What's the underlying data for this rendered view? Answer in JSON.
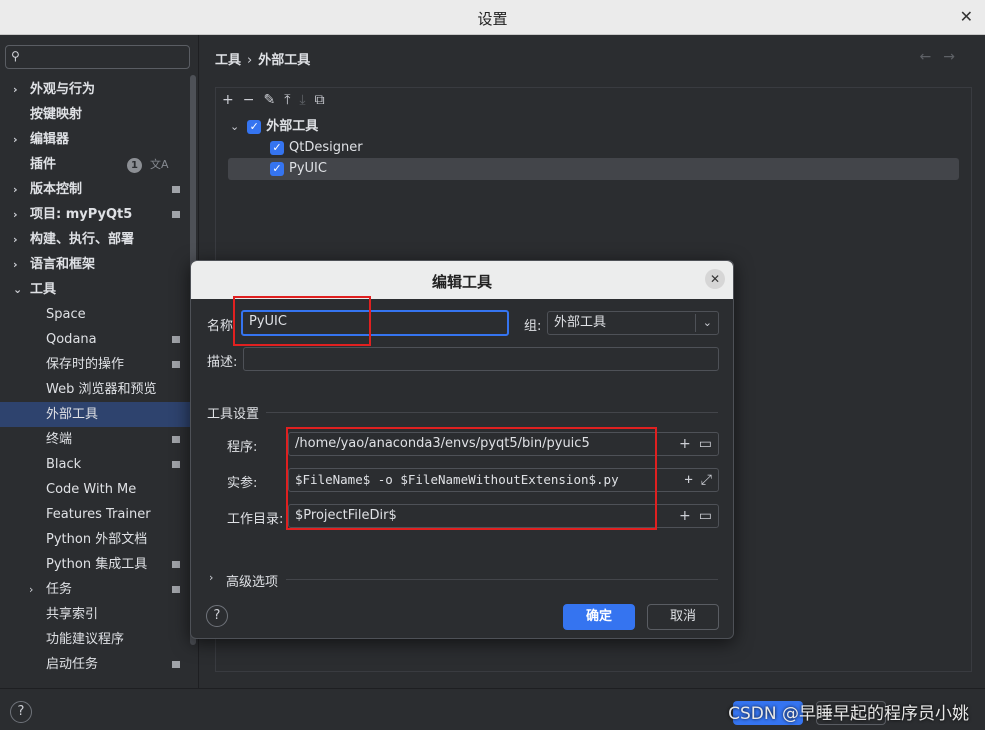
{
  "window": {
    "title": "设置",
    "close": "✕"
  },
  "sidebar": {
    "search_placeholder": "",
    "items": [
      {
        "label": "外观与行为",
        "arrow": "›",
        "top": true
      },
      {
        "label": "按键映射",
        "arrow": "",
        "top": true
      },
      {
        "label": "编辑器",
        "arrow": "›",
        "top": true
      },
      {
        "label": "插件",
        "arrow": "",
        "top": true,
        "badge": "1",
        "trans": "文A"
      },
      {
        "label": "版本控制",
        "arrow": "›",
        "top": true
      },
      {
        "label": "项目: myPyQt5",
        "arrow": "›",
        "top": true
      },
      {
        "label": "构建、执行、部署",
        "arrow": "›",
        "top": true
      },
      {
        "label": "语言和框架",
        "arrow": "›",
        "top": true
      },
      {
        "label": "工具",
        "arrow": "⌄",
        "top": true
      },
      {
        "label": "Space"
      },
      {
        "label": "Qodana"
      },
      {
        "label": "保存时的操作"
      },
      {
        "label": "Web 浏览器和预览"
      },
      {
        "label": "外部工具",
        "selected": true
      },
      {
        "label": "终端"
      },
      {
        "label": "Black"
      },
      {
        "label": "Code With Me"
      },
      {
        "label": "Features Trainer"
      },
      {
        "label": "Python 外部文档"
      },
      {
        "label": "Python 集成工具"
      },
      {
        "label": "任务",
        "arrow": "›"
      },
      {
        "label": "共享索引"
      },
      {
        "label": "功能建议程序"
      },
      {
        "label": "启动任务"
      }
    ]
  },
  "breadcrumb": {
    "parent": "工具",
    "sep": "›",
    "current": "外部工具"
  },
  "nav": {
    "back": "←",
    "forward": "→"
  },
  "toolbar": {
    "add": "+",
    "remove": "−",
    "edit": "✎",
    "up": "⤒",
    "down": "⤓",
    "copy": "⧉"
  },
  "tree": {
    "group": "外部工具",
    "children": [
      "QtDesigner",
      "PyUIC"
    ]
  },
  "dialog": {
    "title": "编辑工具",
    "close": "✕",
    "name_label": "名称",
    "name_value": "PyUIC",
    "group_label": "组:",
    "group_value": "外部工具",
    "desc_label": "描述:",
    "desc_value": "",
    "section_tool": "工具设置",
    "program_label": "程序:",
    "program_value": "/home/yao/anaconda3/envs/pyqt5/bin/pyuic5",
    "args_label": "实参:",
    "args_value": "$FileName$ -o $FileNameWithoutExtension$.py",
    "workdir_label": "工作目录:",
    "workdir_value": "$ProjectFileDir$",
    "advanced_label": "高级选项",
    "help": "?",
    "ok": "确定",
    "cancel": "取消"
  },
  "bottom": {
    "help": "?",
    "watermark": "CSDN @早睡早起的程序员小姚"
  },
  "colors": {
    "accent": "#3574f0",
    "annotation": "#e02020"
  }
}
